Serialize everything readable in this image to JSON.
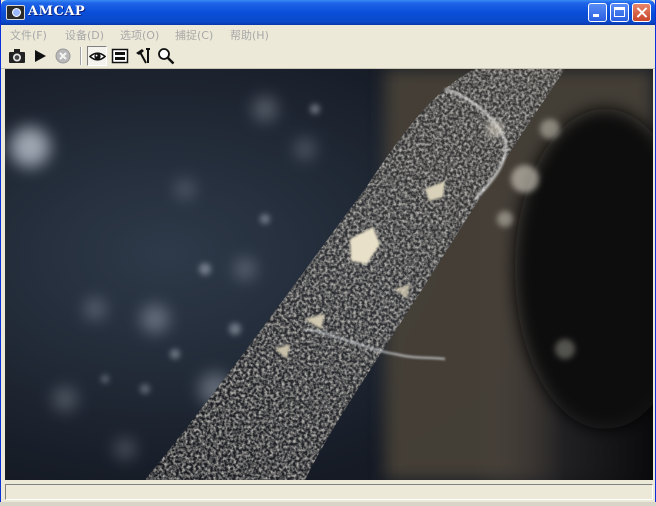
{
  "window": {
    "title": "AMCAP"
  },
  "menu": [
    {
      "label": "文件(F)"
    },
    {
      "label": "设备(D)"
    },
    {
      "label": "选项(O)"
    },
    {
      "label": "捕捉(C)"
    },
    {
      "label": "帮助(H)"
    }
  ],
  "toolbar": {
    "buttons": [
      {
        "icon": "camera-icon"
      },
      {
        "icon": "play-icon"
      },
      {
        "icon": "stop-icon"
      },
      {
        "icon": "eye-icon"
      },
      {
        "icon": "display-icon"
      },
      {
        "icon": "tools-icon"
      },
      {
        "icon": "magnifier-icon"
      }
    ]
  },
  "colors": {
    "titlebar": "#0a4fd9",
    "chrome": "#ece9d8",
    "menu_text_disabled": "#a8a8a8"
  },
  "status": {
    "text": ""
  }
}
